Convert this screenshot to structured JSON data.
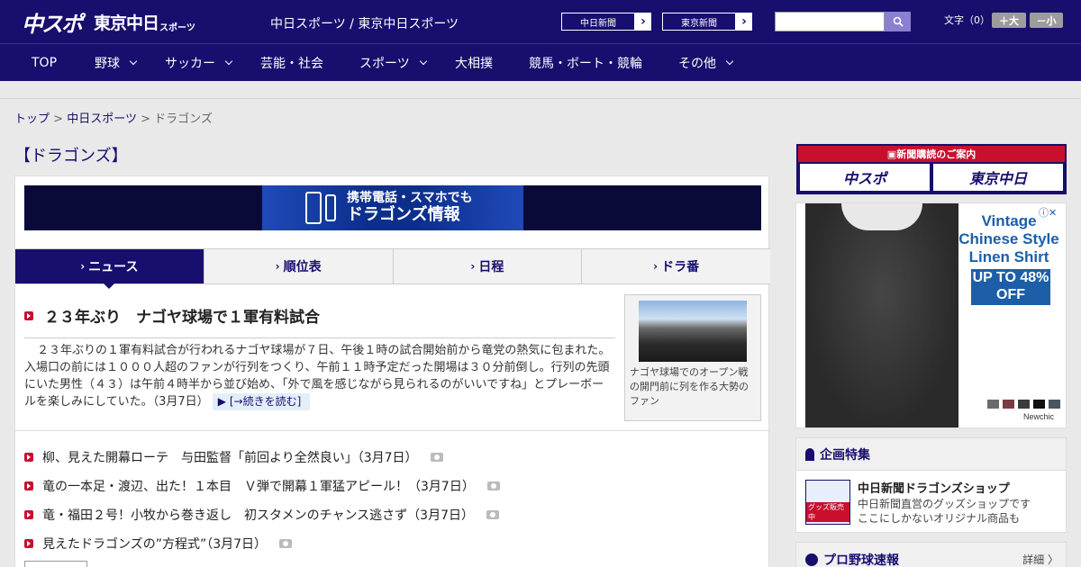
{
  "header": {
    "logo_chunichi_sports": "中スポ",
    "logo_tokyo_chunichi": "東京中日",
    "logo_sports_small": "スポーツ",
    "site_links": "中日スポーツ / 東京中日スポーツ",
    "paper_buttons": [
      "中日新聞",
      "東京新聞"
    ],
    "search_placeholder": "",
    "font_size_label": "文字（0）",
    "font_bigger": "＋大",
    "font_smaller": "－小"
  },
  "nav": {
    "items": [
      {
        "label": "TOP",
        "has_menu": false
      },
      {
        "label": "野球",
        "has_menu": true
      },
      {
        "label": "サッカー",
        "has_menu": true
      },
      {
        "label": "芸能・社会",
        "has_menu": false
      },
      {
        "label": "スポーツ",
        "has_menu": true
      },
      {
        "label": "大相撲",
        "has_menu": false
      },
      {
        "label": "競馬・ボート・競輪",
        "has_menu": false
      },
      {
        "label": "その他",
        "has_menu": true
      }
    ]
  },
  "breadcrumb": {
    "top": "トップ",
    "sep": ">",
    "section": "中日スポーツ",
    "current": "ドラゴンズ"
  },
  "page_title": "【ドラゴンズ】",
  "banner": {
    "line1": "携帯電話・スマホでも",
    "line2": "ドラゴンズ情報"
  },
  "tabs": [
    {
      "label": "ニュース",
      "active": true
    },
    {
      "label": "順位表",
      "active": false
    },
    {
      "label": "日程",
      "active": false
    },
    {
      "label": "ドラ番",
      "active": false
    }
  ],
  "top_story": {
    "headline": "２３年ぶり　ナゴヤ球場で１軍有料試合",
    "lead": "２３年ぶりの１軍有料試合が行われるナゴヤ球場が７日、午後１時の試合開始前から竜党の熱気に包まれた。入場口の前には１０００人超のファンが行列をつくり、午前１１時予定だった開場は３０分前倒し。行列の先頭にいた男性（４３）は午前４時半から並び始め、「外で風を感じながら見られるのがいいですね」とプレーボールを楽しみにしていた。（3月7日）",
    "read_more": "[→続きを読む]",
    "photo_caption": "ナゴヤ球場でのオープン戦の開門前に列を作る大勢のファン"
  },
  "news": [
    {
      "title": "柳、見えた開幕ローテ　与田監督「前回より全然良い」（3月7日）",
      "photo": true
    },
    {
      "title": "竜の一本足・渡辺、出た！１本目　Ｖ弾で開幕１軍猛アピール！（3月7日）",
      "photo": true
    },
    {
      "title": "竜・福田２号！小牧から巻き返し　初スタメンのチャンス逃さず（3月7日）",
      "photo": true
    },
    {
      "title": "見えたドラゴンズの”方程式”（3月7日）",
      "photo": true
    }
  ],
  "sidebar": {
    "subscribe_head": "新聞購読のご案内",
    "subscribe_logos": [
      "中スポ",
      "東京中日"
    ],
    "ad": {
      "title": "Vintage Chinese Style Linen Shirt",
      "offer": "UP TO 48% OFF",
      "brand": "Newchic",
      "swatches": [
        "#6b6b6b",
        "#7a3b45",
        "#3b3b3b",
        "#111111",
        "#4a5560"
      ]
    },
    "feature": {
      "heading": "企画特集",
      "title": "中日新聞ドラゴンズショップ",
      "desc1": "中日新聞直営のグッズショップです",
      "desc2": "ここにしかないオリジナル商品も",
      "thumb_label": "グッズ販売中"
    },
    "score": {
      "heading": "プロ野球速報",
      "more": "詳細 〉"
    }
  },
  "colors": {
    "brand_navy": "#170e6e",
    "accent_red": "#c8102e",
    "ad_blue": "#1c5fa8"
  }
}
